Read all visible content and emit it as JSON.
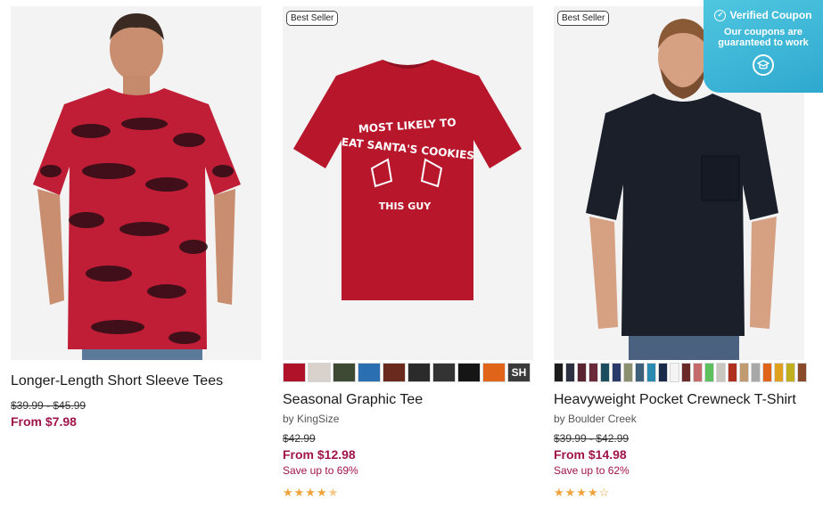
{
  "products": [
    {
      "title": "Longer-Length Short Sleeve Tees",
      "price_was": "$39.99 - $45.99",
      "price_now": "From $7.98"
    },
    {
      "badge": "Best Seller",
      "shirt_text": [
        "MOST LIKELY TO",
        "EAT SANTA'S COOKIES",
        "THIS GUY"
      ],
      "swatch_colors": [
        "#b0122a",
        "#d9d2cc",
        "#3e4a34",
        "#2a6fb2",
        "#6a2a1e",
        "#2b2b2b",
        "#333333",
        "#151515",
        "#e0641a",
        "#3a3a3a"
      ],
      "swatch_last_text": "SH",
      "title": "Seasonal Graphic Tee",
      "brand": "by KingSize",
      "price_was": "$42.99",
      "price_now": "From $12.98",
      "save": "Save up to 69%",
      "rating": 4.5
    },
    {
      "badge": "Best Seller",
      "swatch_colors": [
        "#1c1c1c",
        "#2b3140",
        "#5a2430",
        "#6b2a3a",
        "#1d4e5e",
        "#2a3a6a",
        "#8a9070",
        "#3e5f7a",
        "#2a8ab0",
        "#1a2a4a",
        "#f4f4f4",
        "#6a2a2a",
        "#c46a6a",
        "#5cc05c",
        "#c8c6be",
        "#b03020",
        "#c09a70",
        "#a8a8a8",
        "#e0641a",
        "#e0a020",
        "#c0b020",
        "#8a4a2a"
      ],
      "title": "Heavyweight Pocket Crewneck T-Shirt",
      "brand": "by Boulder Creek",
      "price_was": "$39.99 - $42.99",
      "price_now": "From $14.98",
      "save": "Save up to 62%",
      "rating": 4
    }
  ],
  "coupon": {
    "title": "Verified Coupon",
    "subtitle": "Our coupons are guaranteed to work"
  },
  "colors": {
    "price_accent": "#a0144a",
    "star": "#f0a33a",
    "coupon_bg": "#3bb6d8"
  }
}
